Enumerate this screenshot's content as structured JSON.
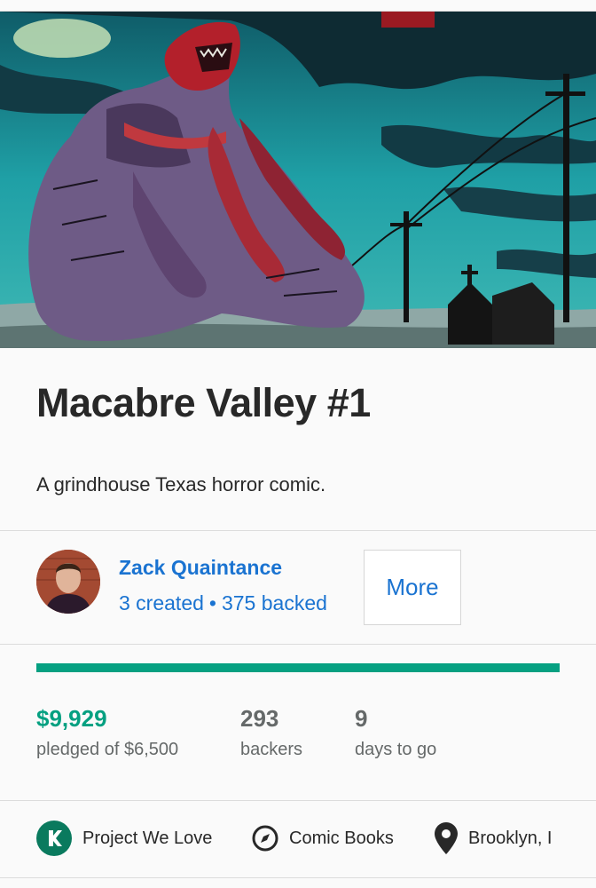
{
  "project": {
    "title": "Macabre Valley #1",
    "blurb": "A grindhouse Texas horror comic."
  },
  "creator": {
    "name": "Zack Quaintance",
    "created": "3 created",
    "separator": "•",
    "backed": "375 backed",
    "more_label": "More"
  },
  "funding": {
    "progress_fraction": 1.0,
    "pledged_amount": "$9,929",
    "pledged_label": "pledged of $6,500",
    "backers_count": "293",
    "backers_label": "backers",
    "days_count": "9",
    "days_label": "days to go"
  },
  "tags": [
    {
      "label": "Project We Love",
      "icon": "kickstarter-badge-icon"
    },
    {
      "label": "Comic Books",
      "icon": "compass-icon"
    },
    {
      "label": "Brooklyn, I",
      "icon": "location-pin-icon"
    }
  ],
  "colors": {
    "accent_green": "#05a081",
    "link_blue": "#1a73d1",
    "text_dark": "#282828",
    "text_muted": "#656969"
  }
}
